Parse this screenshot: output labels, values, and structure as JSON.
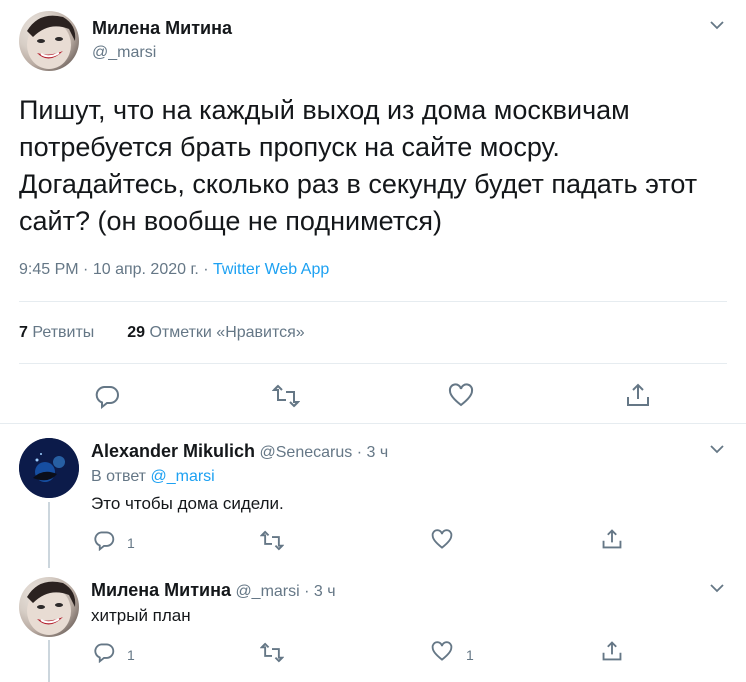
{
  "main_tweet": {
    "author_name": "Милена Митина",
    "author_handle": "@_marsi",
    "text_lines": [
      "Пишут, что на каждый выход из дома москвичам",
      "потребуется брать пропуск на сайте мосру.",
      "Догадайтесь, сколько раз в секунду будет падать этот",
      "сайт? (он вообще не поднимется)"
    ],
    "time": "9:45 PM",
    "dot1": "·",
    "date": "10 апр. 2020 г.",
    "dot2": "·",
    "source": "Twitter Web App",
    "retweets_count": "7",
    "retweets_label": "Ретвиты",
    "likes_count": "29",
    "likes_label": "Отметки «Нравится»"
  },
  "replies": [
    {
      "author_name": "Alexander Mikulich",
      "author_handle": "@Senecarus",
      "dot": "·",
      "time": "3 ч",
      "reply_to_label": "В ответ",
      "reply_to_handle": "@_marsi",
      "text": "Это чтобы дома сидели.",
      "reply_count": "1",
      "retweet_count": "",
      "like_count": ""
    },
    {
      "author_name": "Милена Митина",
      "author_handle": "@_marsi",
      "dot": "·",
      "time": "3 ч",
      "text": "хитрый план",
      "reply_count": "1",
      "retweet_count": "",
      "like_count": "1"
    }
  ],
  "colors": {
    "accent": "#1da1f2",
    "muted": "#657786",
    "text": "#14171a",
    "divider": "#e6ecf0"
  },
  "icons": [
    "chevron-down-icon",
    "reply-icon",
    "retweet-icon",
    "like-icon",
    "share-icon"
  ]
}
